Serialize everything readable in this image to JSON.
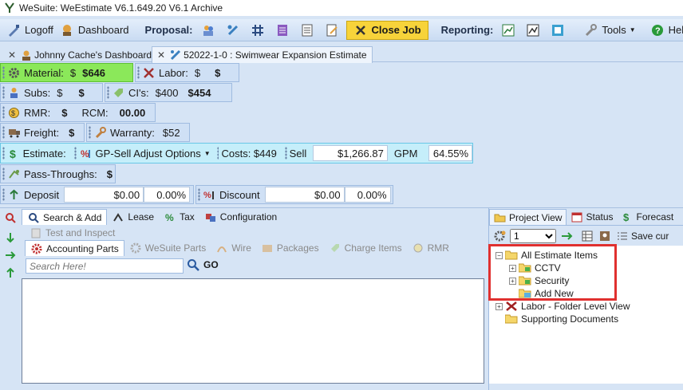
{
  "window": {
    "title": "WeSuite: WeEstimate V6.1.649.20 V6.1 Archive"
  },
  "menubar": {
    "logoff": "Logoff",
    "dashboard": "Dashboard",
    "proposal_label": "Proposal:",
    "close_job": "Close Job",
    "reporting_label": "Reporting:",
    "tools": "Tools",
    "help": "Help"
  },
  "doc_tabs": [
    {
      "label": "Johnny Cache's Dashboard"
    },
    {
      "label": "52022-1-0 : Swimwear Expansion Estimate"
    }
  ],
  "summary": {
    "material_label": "Material:",
    "material_currency": "$",
    "material_value": "$646",
    "labor_label": "Labor:",
    "labor_currency": "$",
    "labor_value": "$",
    "subs_label": "Subs:",
    "subs_currency": "$",
    "subs_value": "$",
    "cis_label": "CI's:",
    "cis_cost": "$400",
    "cis_value": "$454",
    "rmr_label": "RMR:",
    "rmr_value": "$",
    "rcm_label": "RCM:",
    "rcm_value": "00.00",
    "freight_label": "Freight:",
    "freight_value": "$",
    "warranty_label": "Warranty:",
    "warranty_value": "$52",
    "estimate_label": "Estimate:",
    "gp_sell_options": "GP-Sell Adjust Options",
    "costs": "Costs: $449",
    "sell_label": "Sell",
    "sell_value": "$1,266.87",
    "gpm_label": "GPM",
    "gpm_value": "64.55%",
    "pass_label": "Pass-Throughs:",
    "pass_value": "$",
    "deposit_label": "Deposit",
    "deposit_amount": "$0.00",
    "deposit_pct": "0.00%",
    "discount_label": "Discount",
    "discount_amount": "$0.00",
    "discount_pct": "0.00%"
  },
  "parts_panel": {
    "top_tabs": [
      "Search & Add",
      "Lease",
      "Tax",
      "Configuration"
    ],
    "sub_tab_disabled": "Test and Inspect",
    "sub_tabs": [
      "Accounting Parts",
      "WeSuite Parts",
      "Wire",
      "Packages",
      "Charge Items",
      "RMR"
    ],
    "search_placeholder": "Search Here!",
    "go_label": "GO"
  },
  "project_panel": {
    "tabs": [
      "Project View",
      "Status",
      "Forecast"
    ],
    "level_value": "1",
    "save_label": "Save cur",
    "tree": {
      "root": "All Estimate Items",
      "children": [
        "CCTV",
        "Security",
        "Add New"
      ],
      "labor": "Labor - Folder Level View",
      "docs": "Supporting Documents"
    }
  },
  "colors": {
    "accent_green": "#8be85a",
    "estimate_cyan": "#c5eefa",
    "close_job_yellow": "#f7d33a",
    "highlight_red": "#e0302f"
  }
}
